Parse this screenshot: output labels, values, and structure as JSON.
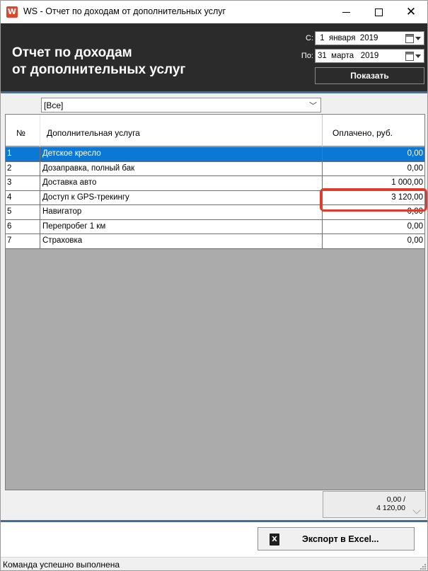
{
  "window": {
    "title": "WS - Отчет по доходам от дополнительных услуг",
    "app_icon_letter": "W",
    "controls": {
      "minimize": "minimize-icon",
      "maximize": "maximize-icon",
      "close": "close-icon"
    }
  },
  "header": {
    "title_line1": "Отчет по доходам",
    "title_line2": "от дополнительных услуг",
    "from_label": "С:",
    "to_label": "По:",
    "date_from": " 1  января  2019",
    "date_to": "31  марта   2019",
    "show_button": "Показать"
  },
  "filter": {
    "selected": "[Все]"
  },
  "table": {
    "columns": {
      "num": "№",
      "service": "Дополнительная услуга",
      "paid": "Оплачено, руб."
    },
    "rows": [
      {
        "num": "1",
        "service": "Детское кресло",
        "paid": "0,00"
      },
      {
        "num": "2",
        "service": "Дозаправка, полный бак",
        "paid": "0,00"
      },
      {
        "num": "3",
        "service": "Доставка авто",
        "paid": "1 000,00"
      },
      {
        "num": "4",
        "service": "Доступ к GPS-трекингу",
        "paid": "3 120,00"
      },
      {
        "num": "5",
        "service": "Навигатор",
        "paid": "0,00"
      },
      {
        "num": "6",
        "service": "Перепробег 1 км",
        "paid": "0,00"
      },
      {
        "num": "7",
        "service": "Страховка",
        "paid": "0,00"
      }
    ],
    "selected_row": 1,
    "highlighted_row": 4
  },
  "summary": {
    "text": "0,00 /\n4 120,00"
  },
  "export_button": "Экспорт в Excel...",
  "status": "Команда успешно выполнена",
  "colors": {
    "header_bg": "#2b2b2b",
    "accent_line": "#3a6ea5",
    "selection": "#0a78d4",
    "highlight": "#e03a2b"
  }
}
